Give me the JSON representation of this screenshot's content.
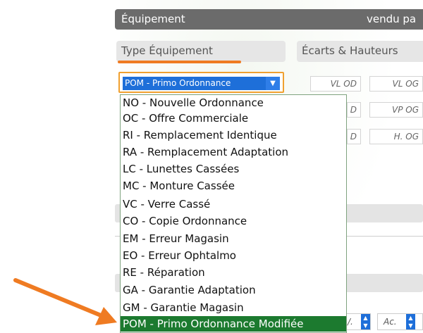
{
  "header": {
    "title": "Équipement",
    "right_text": "vendu pa"
  },
  "tabs": [
    {
      "label": "Type Équipement",
      "active": true
    },
    {
      "label": "Écarts & Hauteurs",
      "active": false
    }
  ],
  "type_select": {
    "value": "POM - Primo Ordonnance"
  },
  "fields": {
    "vl_od": "VL OD",
    "vl_og": "VL OG",
    "vp_od_partial": "D",
    "vp_og": "VP OG",
    "h_od_partial": "D",
    "h_og": "H. OG"
  },
  "dropdown": {
    "options": [
      "NO - Nouvelle Ordonnance",
      "OC - Offre Commerciale",
      "RI - Remplacement Identique",
      "RA - Remplacement Adaptation",
      "LC - Lunettes Cassées",
      "MC - Monture Cassée",
      "VC - Verre Cassé",
      "CO - Copie Ordonnance",
      "EM - Erreur Magasin",
      "EO - Erreur Ophtalmo",
      "RE - Réparation",
      "GA - Garantie Adaptation",
      "GM - Garantie Magasin",
      "POM - Primo Ordonnance Modifiée"
    ],
    "selected_index": 13
  },
  "bottom": {
    "field1_partial": "/.",
    "field2": "Ac."
  },
  "colors": {
    "header_bg": "#6b6b6b",
    "accent_orange": "#ef7b22",
    "select_blue": "#1e6fd9",
    "selected_green": "#1c7a2f"
  },
  "icons": {
    "select_arrow": "chevron-down-icon",
    "annotation_arrow": "arrow-pointer-icon"
  }
}
